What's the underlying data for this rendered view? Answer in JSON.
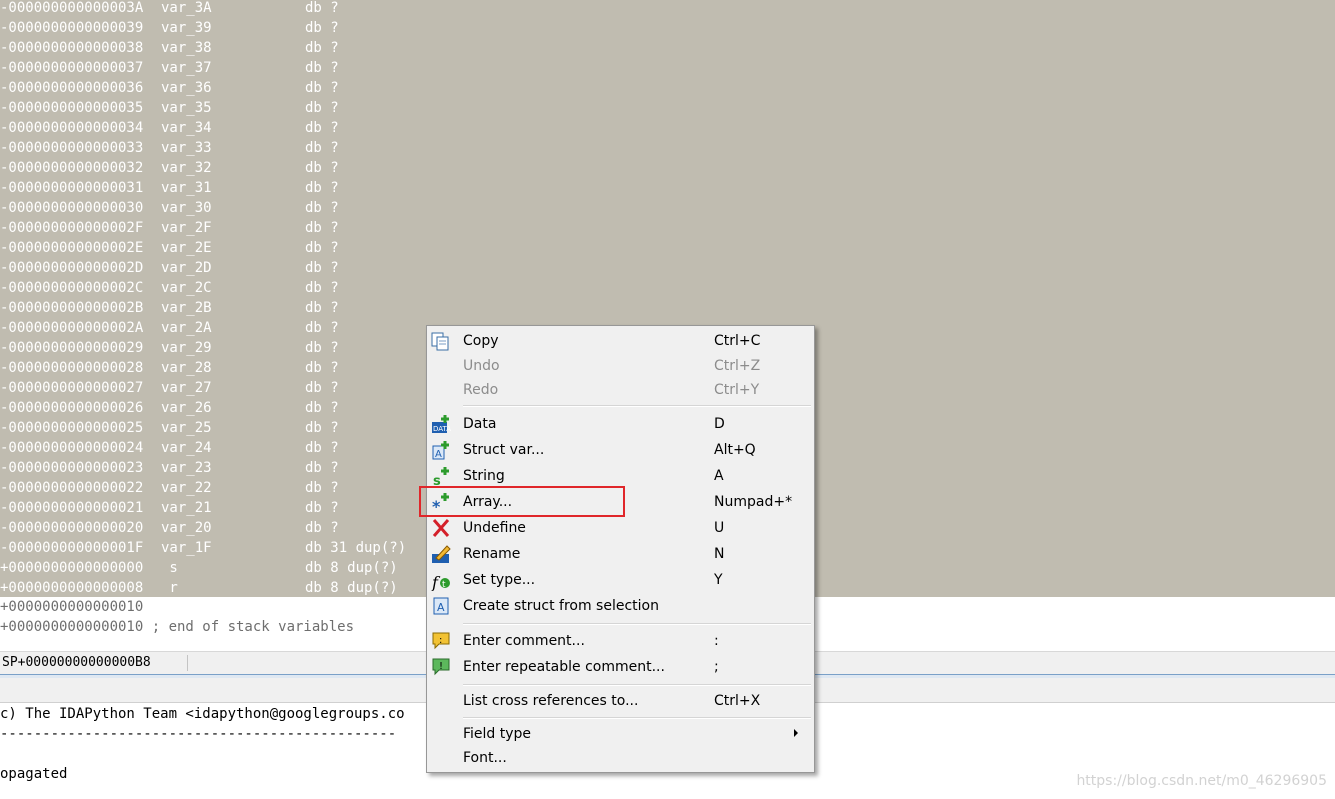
{
  "stack_rows": [
    {
      "offset": "-000000000000003A",
      "name": "var_3A",
      "type": "db ?"
    },
    {
      "offset": "-0000000000000039",
      "name": "var_39",
      "type": "db ?"
    },
    {
      "offset": "-0000000000000038",
      "name": "var_38",
      "type": "db ?"
    },
    {
      "offset": "-0000000000000037",
      "name": "var_37",
      "type": "db ?"
    },
    {
      "offset": "-0000000000000036",
      "name": "var_36",
      "type": "db ?"
    },
    {
      "offset": "-0000000000000035",
      "name": "var_35",
      "type": "db ?"
    },
    {
      "offset": "-0000000000000034",
      "name": "var_34",
      "type": "db ?"
    },
    {
      "offset": "-0000000000000033",
      "name": "var_33",
      "type": "db ?"
    },
    {
      "offset": "-0000000000000032",
      "name": "var_32",
      "type": "db ?"
    },
    {
      "offset": "-0000000000000031",
      "name": "var_31",
      "type": "db ?"
    },
    {
      "offset": "-0000000000000030",
      "name": "var_30",
      "type": "db ?"
    },
    {
      "offset": "-000000000000002F",
      "name": "var_2F",
      "type": "db ?"
    },
    {
      "offset": "-000000000000002E",
      "name": "var_2E",
      "type": "db ?"
    },
    {
      "offset": "-000000000000002D",
      "name": "var_2D",
      "type": "db ?"
    },
    {
      "offset": "-000000000000002C",
      "name": "var_2C",
      "type": "db ?"
    },
    {
      "offset": "-000000000000002B",
      "name": "var_2B",
      "type": "db ?"
    },
    {
      "offset": "-000000000000002A",
      "name": "var_2A",
      "type": "db ?"
    },
    {
      "offset": "-0000000000000029",
      "name": "var_29",
      "type": "db ?"
    },
    {
      "offset": "-0000000000000028",
      "name": "var_28",
      "type": "db ?"
    },
    {
      "offset": "-0000000000000027",
      "name": "var_27",
      "type": "db ?"
    },
    {
      "offset": "-0000000000000026",
      "name": "var_26",
      "type": "db ?"
    },
    {
      "offset": "-0000000000000025",
      "name": "var_25",
      "type": "db ?"
    },
    {
      "offset": "-0000000000000024",
      "name": "var_24",
      "type": "db ?"
    },
    {
      "offset": "-0000000000000023",
      "name": "var_23",
      "type": "db ?"
    },
    {
      "offset": "-0000000000000022",
      "name": "var_22",
      "type": "db ?"
    },
    {
      "offset": "-0000000000000021",
      "name": "var_21",
      "type": "db ?"
    },
    {
      "offset": "-0000000000000020",
      "name": "var_20",
      "type": "db ?"
    },
    {
      "offset": "-000000000000001F",
      "name": "var_1F",
      "type": "db 31 dup(?)"
    },
    {
      "offset": "+0000000000000000",
      "name": " s",
      "type": "db 8 dup(?)"
    },
    {
      "offset": "+0000000000000008",
      "name": " r",
      "type": "db 8 dup(?)"
    }
  ],
  "stack_tail": [
    "+0000000000000010",
    "+0000000000000010 ; end of stack variables"
  ],
  "status": {
    "sp": "SP+00000000000000B8"
  },
  "output": {
    "lines": [
      "c) The IDAPython Team <idapython@googlegroups.co",
      "-----------------------------------------------",
      "",
      "opagated"
    ]
  },
  "context_menu": {
    "copy": {
      "label": "Copy",
      "shortcut": "Ctrl+C"
    },
    "undo": {
      "label": "Undo",
      "shortcut": "Ctrl+Z"
    },
    "redo": {
      "label": "Redo",
      "shortcut": "Ctrl+Y"
    },
    "data": {
      "label": "Data",
      "shortcut": "D"
    },
    "struct_var": {
      "label": "Struct var...",
      "shortcut": "Alt+Q"
    },
    "string": {
      "label": "String",
      "shortcut": "A"
    },
    "array": {
      "label": "Array...",
      "shortcut": "Numpad+*"
    },
    "undefine": {
      "label": "Undefine",
      "shortcut": "U"
    },
    "rename": {
      "label": "Rename",
      "shortcut": "N"
    },
    "set_type": {
      "label": "Set type...",
      "shortcut": "Y"
    },
    "create_struct": {
      "label": "Create struct from selection",
      "shortcut": ""
    },
    "enter_comment": {
      "label": "Enter comment...",
      "shortcut": ":"
    },
    "enter_rep_comment": {
      "label": "Enter repeatable comment...",
      "shortcut": ";"
    },
    "xrefs": {
      "label": "List cross references to...",
      "shortcut": "Ctrl+X"
    },
    "field_type": {
      "label": "Field type",
      "shortcut": ""
    },
    "font": {
      "label": "Font...",
      "shortcut": ""
    }
  },
  "watermark": "https://blog.csdn.net/m0_46296905",
  "colors": {
    "selection_bg": "#c0bcb0",
    "highlight_box": "#e0262a",
    "menu_bg": "#f0f0f0"
  }
}
